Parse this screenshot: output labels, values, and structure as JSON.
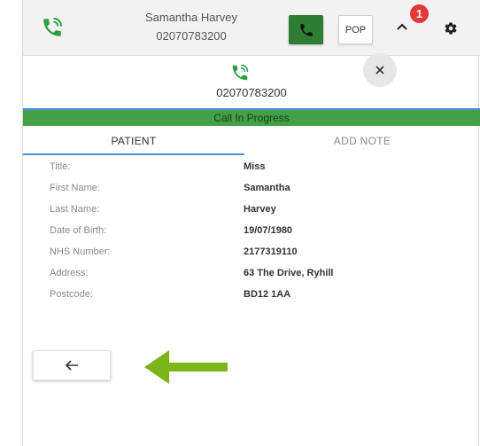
{
  "caller": {
    "name": "Samantha Harvey",
    "number": "02070783200"
  },
  "toolbar": {
    "pop_label": "POP",
    "notification_count": "1"
  },
  "call": {
    "number": "02070783200",
    "status": "Call In Progress"
  },
  "tabs": [
    {
      "label": "PATIENT",
      "active": true
    },
    {
      "label": "ADD NOTE",
      "active": false
    }
  ],
  "patient": {
    "fields": [
      {
        "label": "Title:",
        "value": "Miss"
      },
      {
        "label": "First Name:",
        "value": "Samantha"
      },
      {
        "label": "Last Name:",
        "value": "Harvey"
      },
      {
        "label": "Date of Birth:",
        "value": "19/07/1980"
      },
      {
        "label": "NHS Number:",
        "value": "2177319110"
      },
      {
        "label": "Address:",
        "value": "63 The Drive, Ryhill"
      },
      {
        "label": "Postcode:",
        "value": "BD12 1AA"
      }
    ]
  },
  "icons": {
    "top_call": "phone-in-call-icon",
    "answer": "phone-icon",
    "chevron": "chevron-up-icon",
    "settings": "gear-icon",
    "close": "close-icon",
    "back": "arrow-left-icon",
    "pointer": "arrow-pointer-icon"
  },
  "colors": {
    "accent_green": "#43a047",
    "button_green": "#2e7d32",
    "tab_blue": "#4a90e2",
    "badge_red": "#e53935",
    "pointer_green": "#7cb518"
  }
}
